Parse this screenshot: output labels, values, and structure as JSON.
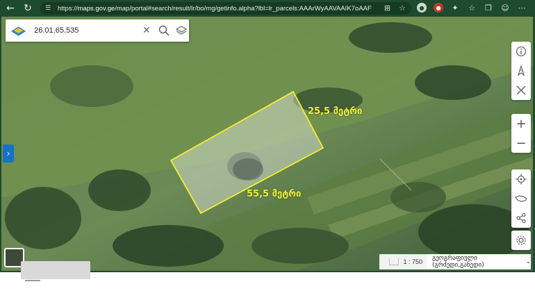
{
  "browser": {
    "url_prefix": "https://",
    "url_host": "maps.gov.ge",
    "url_path": "/map/portal#search/result/lr/bo/mg/getinfo.alpha?lbl=lr_parcels:AAArWyAAVAAIK7oAAF"
  },
  "search": {
    "value": "26.01.65.535"
  },
  "map": {
    "measure_short": "25,5 მეტრი",
    "measure_long": "55,5 მეტრი",
    "parcel_stroke_color": "#f2ef2a",
    "parcel_fill_color": "#ffffff"
  },
  "toolbar": {
    "info_icon": "info-icon",
    "north_icon": "compass-north-icon",
    "measure_icon": "measure-tools-icon",
    "zoom_in_label": "+",
    "zoom_out_label": "−"
  },
  "footer": {
    "scale_text": "1 : 750",
    "basemap_label": "გეოგრაფიული (გრძედი,განედი)"
  }
}
